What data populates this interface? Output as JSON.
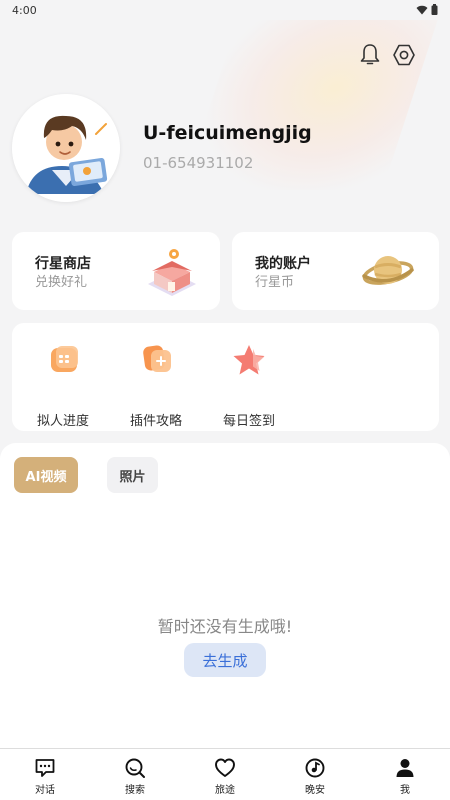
{
  "status": {
    "time": "4:00"
  },
  "header": {
    "bell_icon": "bell-icon",
    "settings_icon": "settings-icon"
  },
  "profile": {
    "username": "U-feicuimengjig",
    "user_id": "01-654931102",
    "avatar_icon": "cartoon-boy-laptop-avatar"
  },
  "cards": {
    "shop": {
      "title": "行星商店",
      "subtitle": "兑换好礼",
      "icon": "store-icon"
    },
    "account": {
      "title": "我的账户",
      "subtitle": "行星币",
      "icon": "planet-icon"
    }
  },
  "tools": [
    {
      "label": "拟人进度",
      "icon": "calendar-icon"
    },
    {
      "label": "插件攻略",
      "icon": "plugin-icon"
    },
    {
      "label": "每日签到",
      "icon": "star-icon"
    }
  ],
  "tabs": [
    {
      "label": "AI视频",
      "active": true
    },
    {
      "label": "照片",
      "active": false
    }
  ],
  "empty_state": {
    "message": "暂时还没有生成哦!",
    "button_label": "去生成"
  },
  "bottom_nav": [
    {
      "label": "对话",
      "icon": "chat-icon"
    },
    {
      "label": "搜索",
      "icon": "search-icon"
    },
    {
      "label": "旅途",
      "icon": "heart-icon"
    },
    {
      "label": "晚安",
      "icon": "music-note-icon"
    },
    {
      "label": "我",
      "icon": "person-icon"
    }
  ],
  "colors": {
    "accent_tab": "#d4b07a",
    "generate_button_bg": "#dde6f6",
    "generate_button_text": "#3a6fd8"
  }
}
